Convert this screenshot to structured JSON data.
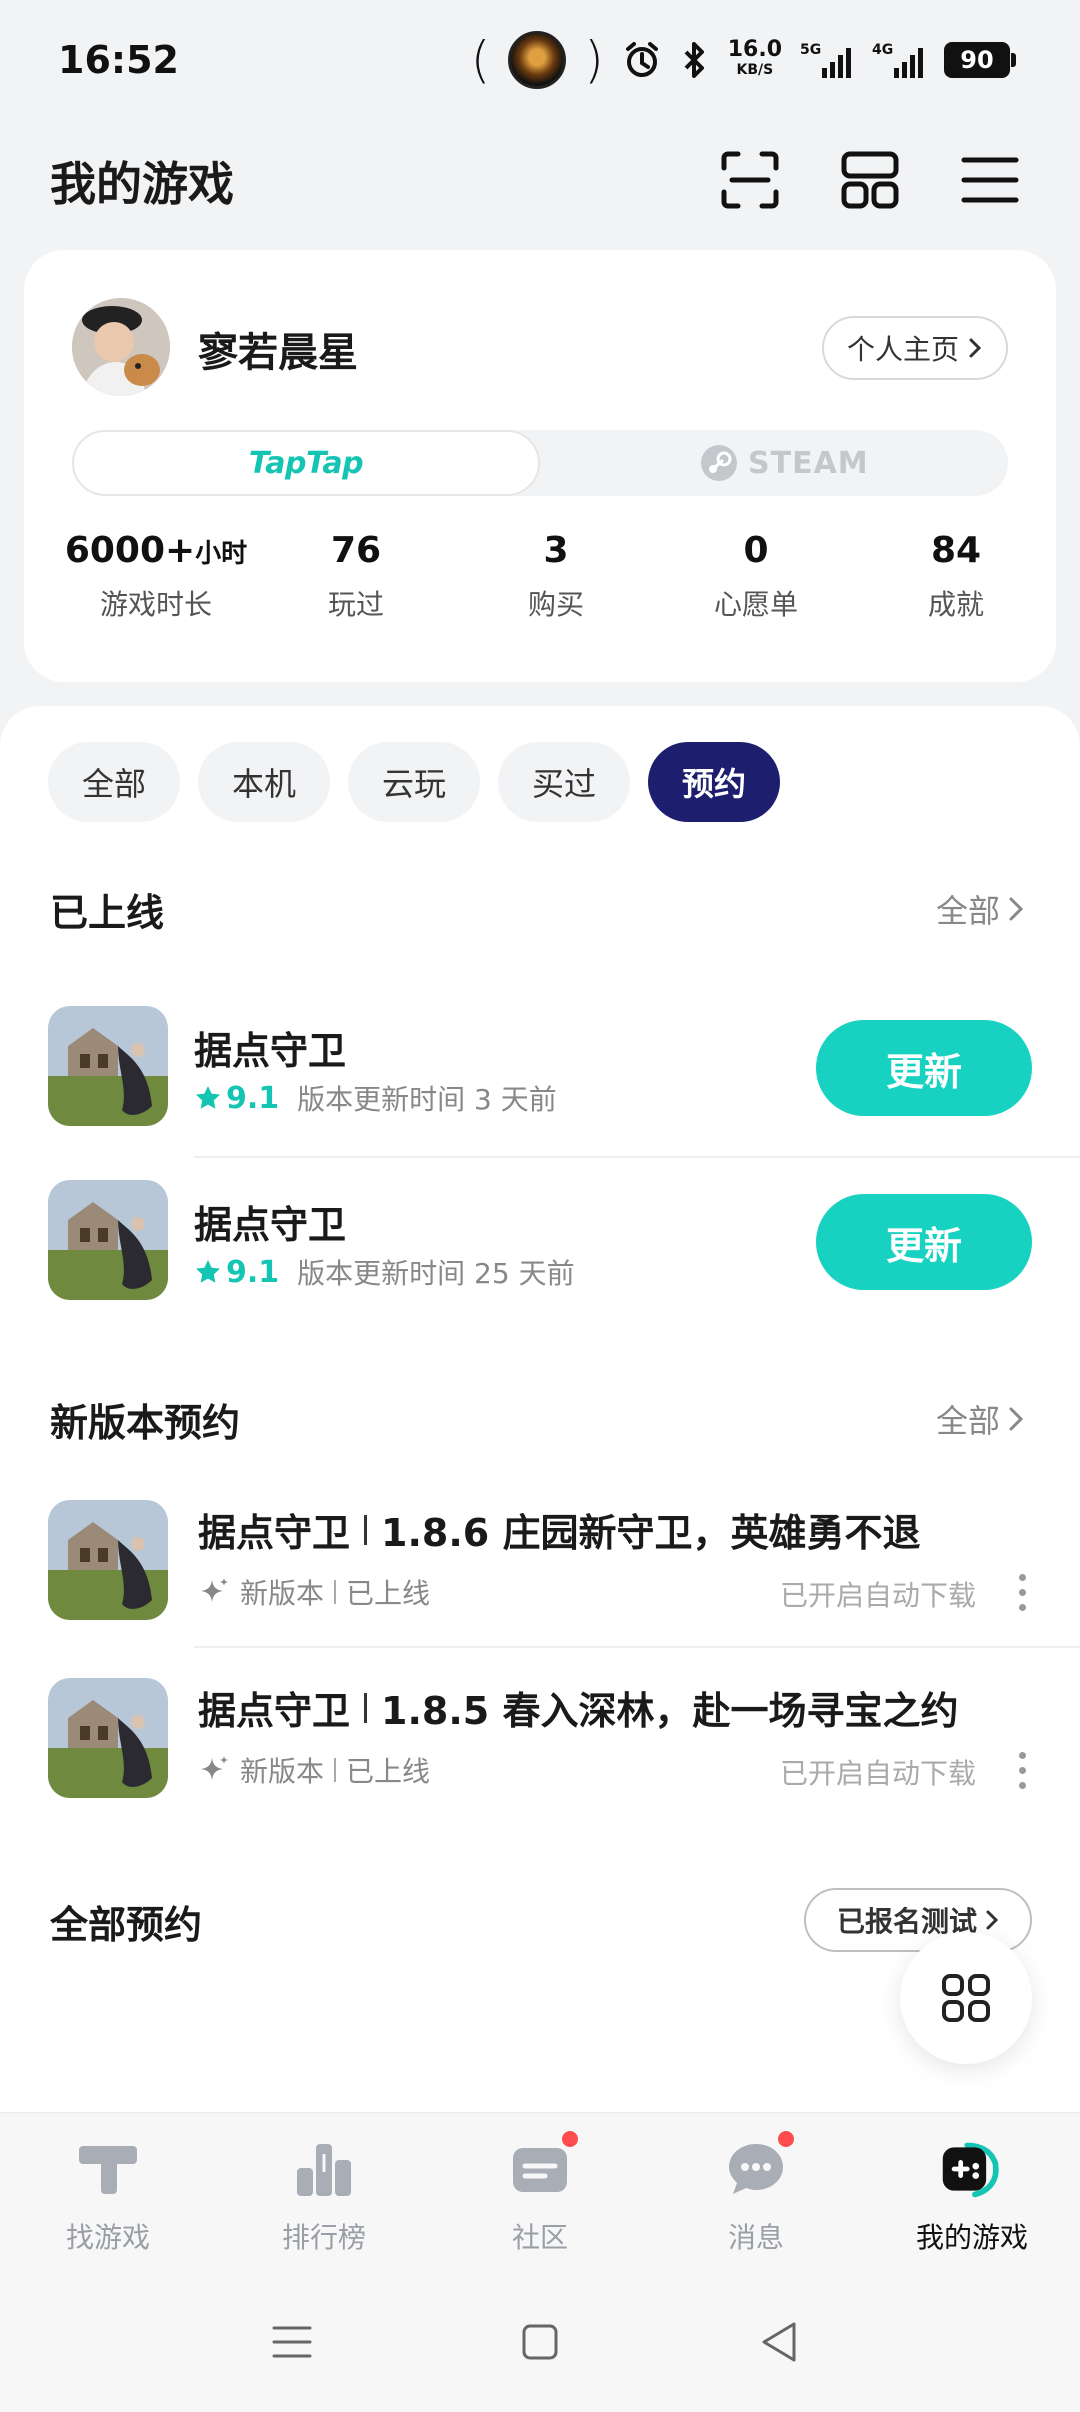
{
  "status_bar": {
    "time": "16:52",
    "net_speed": "16.0",
    "net_speed_unit": "KB/S",
    "signal_1": "5G",
    "signal_2": "4G",
    "battery": "90"
  },
  "header": {
    "title": "我的游戏"
  },
  "profile": {
    "username": "寥若晨星",
    "home_button": "个人主页",
    "platforms": {
      "active": "TapTap",
      "inactive": "STEAM"
    },
    "stats": [
      {
        "value": "6000+",
        "unit": "小时",
        "label": "游戏时长"
      },
      {
        "value": "76",
        "unit": "",
        "label": "玩过"
      },
      {
        "value": "3",
        "unit": "",
        "label": "购买"
      },
      {
        "value": "0",
        "unit": "",
        "label": "心愿单"
      },
      {
        "value": "84",
        "unit": "",
        "label": "成就"
      }
    ]
  },
  "filters": [
    "全部",
    "本机",
    "云玩",
    "买过",
    "预约"
  ],
  "active_filter": "预约",
  "released": {
    "title": "已上线",
    "see_all": "全部",
    "items": [
      {
        "name": "据点守卫",
        "rating": "9.1",
        "update_time": "版本更新时间 3 天前",
        "button": "更新"
      },
      {
        "name": "据点守卫",
        "rating": "9.1",
        "update_time": "版本更新时间 25 天前",
        "button": "更新"
      }
    ]
  },
  "new_version": {
    "title": "新版本预约",
    "see_all": "全部",
    "items": [
      {
        "name": "据点守卫",
        "version": "1.8.6 庄园新守卫，英雄勇不退",
        "tag1": "新版本",
        "tag2": "已上线",
        "status": "已开启自动下载"
      },
      {
        "name": "据点守卫",
        "version": "1.8.5 春入深林，赴一场寻宝之约",
        "tag1": "新版本",
        "tag2": "已上线",
        "status": "已开启自动下载"
      }
    ]
  },
  "all_reservations": {
    "title": "全部预约",
    "signup_button": "已报名测试"
  },
  "bottom_nav": [
    {
      "label": "找游戏",
      "icon": "find-games-icon",
      "badge": false
    },
    {
      "label": "排行榜",
      "icon": "ranking-icon",
      "badge": false
    },
    {
      "label": "社区",
      "icon": "community-icon",
      "badge": true
    },
    {
      "label": "消息",
      "icon": "message-icon",
      "badge": true
    },
    {
      "label": "我的游戏",
      "icon": "my-games-icon",
      "badge": false
    }
  ],
  "colors": {
    "accent": "#15c5b4",
    "update_button": "#17d2c0",
    "active_chip": "#1d1f6e",
    "badge": "#ff4d4f"
  }
}
